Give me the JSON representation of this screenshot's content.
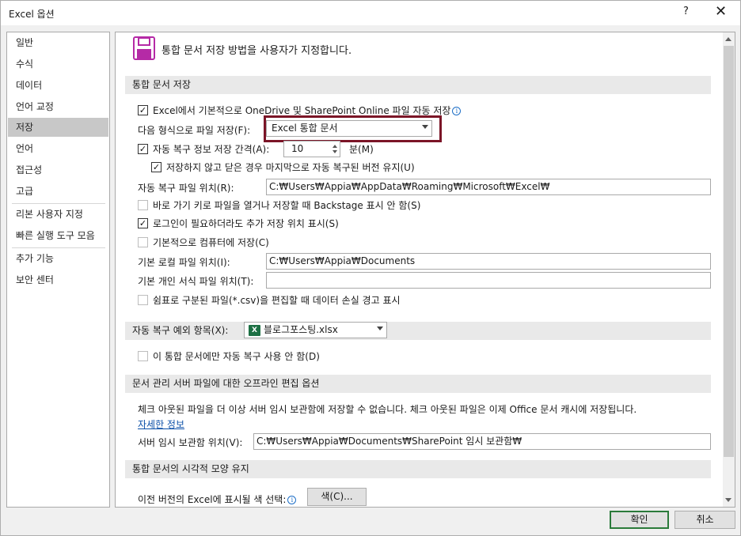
{
  "window": {
    "title": "Excel 옵션",
    "help": "?",
    "close": "✕"
  },
  "sidebar": {
    "items": [
      {
        "label": "일반"
      },
      {
        "label": "수식"
      },
      {
        "label": "데이터"
      },
      {
        "label": "언어 교정"
      },
      {
        "label": "저장",
        "selected": true
      },
      {
        "label": "언어"
      },
      {
        "label": "접근성"
      },
      {
        "label": "고급"
      },
      {
        "label": "리본 사용자 지정"
      },
      {
        "label": "빠른 실행 도구 모음"
      },
      {
        "label": "추가 기능"
      },
      {
        "label": "보안 센터"
      }
    ]
  },
  "main": {
    "header": {
      "text": "통합 문서 저장 방법을 사용자가 지정합니다.",
      "icon": "floppy-disk-icon",
      "icon_color": "#b52aa6"
    },
    "save_section": {
      "title": "통합 문서 저장",
      "autosave_onedrive": {
        "label": "Excel에서 기본적으로 OneDrive 및 SharePoint Online 파일 자동 저장",
        "checked": true
      },
      "format_label": "다음 형식으로 파일 저장(F):",
      "format_value": "Excel 통합 문서",
      "autorecover_interval": {
        "label": "자동 복구 정보 저장 간격(A):",
        "checked": true,
        "value": "10",
        "unit": "분(M)"
      },
      "keep_last_version": {
        "label": "저장하지 않고 닫은 경우 마지막으로 자동 복구된 버전 유지(U)",
        "checked": true
      },
      "autorecover_location": {
        "label": "자동 복구 파일 위치(R):",
        "value": "C:₩Users₩Appia₩AppData₩Roaming₩Microsoft₩Excel₩"
      },
      "no_backstage": {
        "label": "바로 가기 키로 파일을 열거나 저장할 때 Backstage 표시 안 함(S)",
        "checked": false
      },
      "show_additional": {
        "label": "로그인이 필요하더라도 추가 저장 위치 표시(S)",
        "checked": true
      },
      "save_to_computer": {
        "label": "기본적으로 컴퓨터에 저장(C)",
        "checked": false
      },
      "default_local": {
        "label": "기본 로컬 파일 위치(I):",
        "value": "C:₩Users₩Appia₩Documents"
      },
      "personal_templates": {
        "label": "기본 개인 서식 파일 위치(T):",
        "value": ""
      },
      "csv_warning": {
        "label": "쉼표로 구분된 파일(*.csv)을 편집할 때 데이터 손실 경고 표시",
        "checked": false
      }
    },
    "autorecover_exceptions": {
      "title": "자동 복구 예외 항목(X):",
      "workbook": "블로그포스팅.xlsx",
      "workbook_icon": "excel-file-icon",
      "disable_autorecover": {
        "label": "이 통합 문서에만 자동 복구 사용 안 함(D)",
        "checked": false
      }
    },
    "offline_editing": {
      "title": "문서 관리 서버 파일에 대한 오프라인 편집 옵션",
      "description": "체크 아웃된 파일을 더 이상 서버 임시 보관함에 저장할 수 없습니다. 체크 아웃된 파일은 이제 Office 문서 캐시에 저장됩니다.",
      "more_info": "자세한 정보",
      "drafts_label": "서버 임시 보관함 위치(V):",
      "drafts_value": "C:₩Users₩Appia₩Documents₩SharePoint 임시 보관함₩"
    },
    "visual_appearance": {
      "title": "통합 문서의 시각적 모양 유지",
      "colors_label": "이전 버전의 Excel에 표시될 색 선택:",
      "colors_button": "색(C)..."
    }
  },
  "footer": {
    "ok": "확인",
    "cancel": "취소"
  },
  "colors": {
    "highlight_border": "#7b1527",
    "ok_border": "#2a7a3a",
    "link": "#0b4fa8"
  }
}
